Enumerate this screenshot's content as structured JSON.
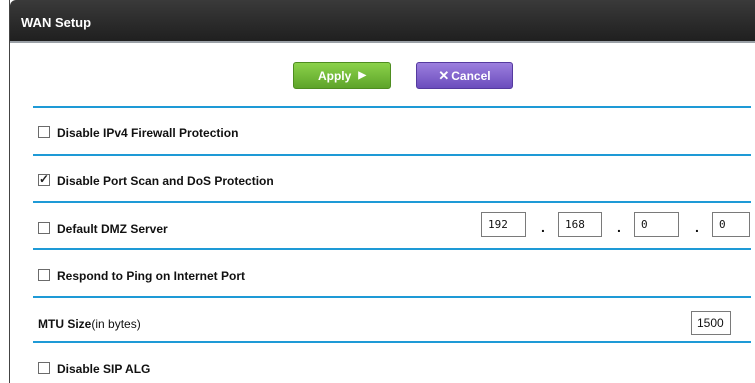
{
  "header": {
    "title": "WAN Setup"
  },
  "actions": {
    "apply_label": "Apply",
    "apply_glyph": "▶",
    "cancel_glyph": "✕",
    "cancel_label": "Cancel"
  },
  "options": {
    "ipv4_firewall": {
      "label": "Disable IPv4 Firewall Protection",
      "checked": false
    },
    "port_scan": {
      "label": "Disable Port Scan and DoS Protection",
      "checked": true
    },
    "dmz": {
      "label": "Default DMZ Server",
      "checked": false,
      "ip": [
        "192",
        "168",
        "0",
        "0"
      ],
      "separator": "."
    },
    "ping": {
      "label": "Respond to Ping on Internet Port",
      "checked": false
    },
    "mtu": {
      "label": "MTU Size",
      "unit": "(in bytes)",
      "value": "1500"
    },
    "sip_alg": {
      "label": "Disable SIP ALG",
      "checked": false
    }
  },
  "colors": {
    "divider": "#1e9ad6",
    "apply": "#6cb633",
    "cancel": "#7a5acb",
    "header": "#2a2a2a"
  }
}
